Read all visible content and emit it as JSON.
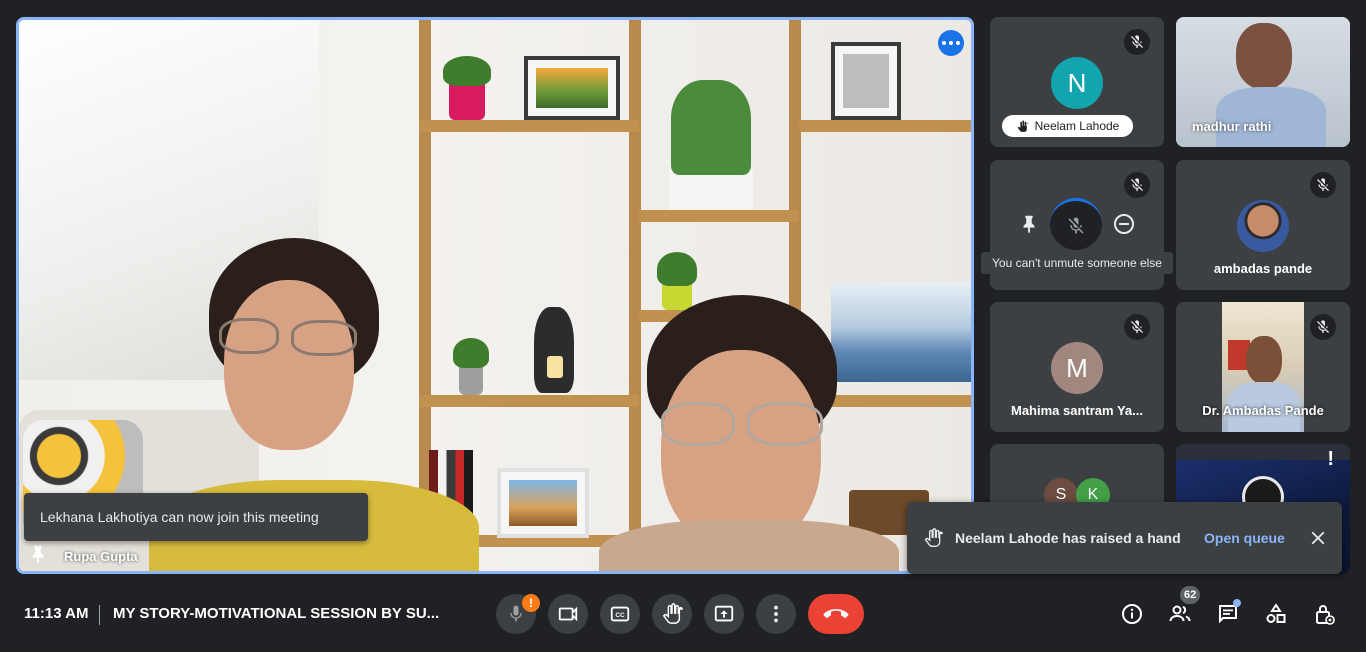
{
  "main_tile": {
    "participant_name": "Rupa Gupta",
    "border_color": "#8ab4f8"
  },
  "notifications": {
    "join_message": "Lekhana Lakhotiya can now join this meeting",
    "hand_message": "Neelam Lahode has raised a hand",
    "hand_action": "Open queue"
  },
  "tiles": {
    "neelam": {
      "initial": "N",
      "name": "Neelam Lahode",
      "avatar_color": "#12a4af",
      "hand_raised": true,
      "muted": true
    },
    "madhur": {
      "name": "madhur rathi",
      "muted": false
    },
    "hovered": {
      "tooltip": "You can't unmute someone else",
      "muted": true
    },
    "ambadas": {
      "name": "ambadas pande",
      "muted": true
    },
    "mahima": {
      "initial": "M",
      "name": "Mahima santram Ya...",
      "avatar_color": "#a1887f",
      "muted": true
    },
    "dr_ambadas": {
      "name": "Dr. Ambadas Pande",
      "muted": true
    },
    "group": {
      "initials": [
        "S",
        "K"
      ],
      "avatar_colors": [
        "#6d4c41",
        "#43a047"
      ]
    },
    "alert": {
      "mark": "!"
    }
  },
  "bottom_bar": {
    "time": "11:13 AM",
    "meeting_title": "MY STORY-MOTIVATIONAL SESSION BY SU...",
    "mic_warning": "!",
    "participant_count": "62"
  },
  "icons": {
    "mic": "mic-off-icon",
    "camera": "videocam-icon",
    "captions": "closed-caption-icon",
    "hand": "raise-hand-icon",
    "present": "present-screen-icon",
    "more": "more-vert-icon",
    "leave": "call-end-icon",
    "info": "info-icon",
    "people": "people-icon",
    "chat": "chat-icon",
    "activities": "activities-icon",
    "host_controls": "host-controls-icon"
  },
  "colors": {
    "background": "#202124",
    "tile": "#3c4043",
    "accent": "#8ab4f8",
    "leave": "#ea4335",
    "warning": "#fa7b17"
  }
}
